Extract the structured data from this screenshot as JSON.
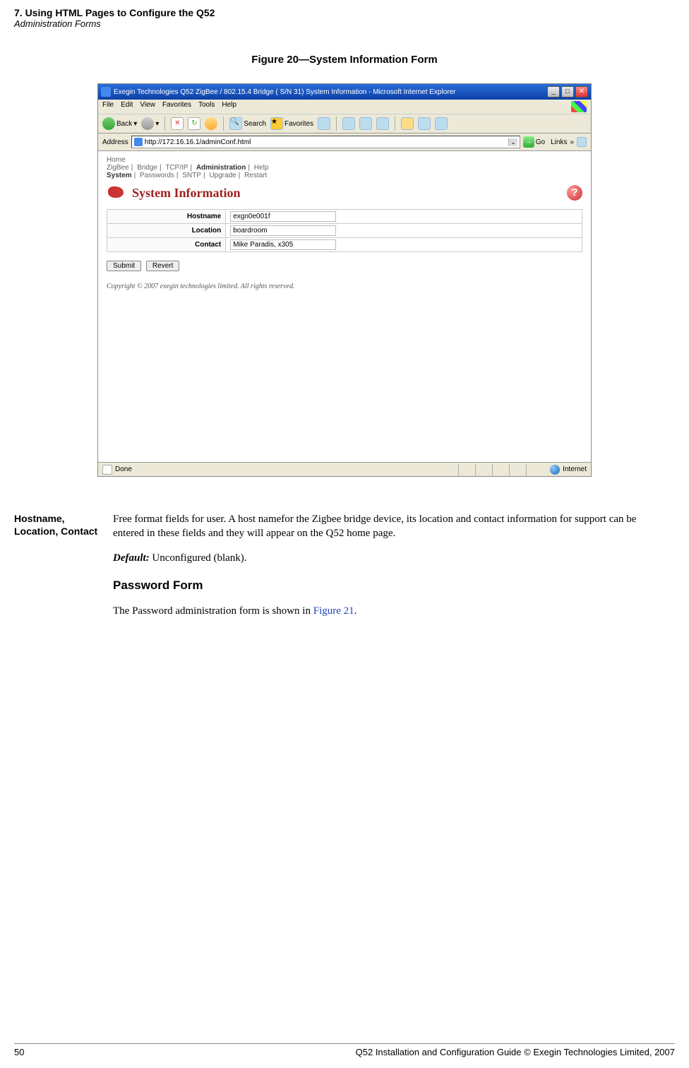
{
  "header": {
    "chapter": "7. Using HTML Pages to Configure the Q52",
    "section": "Administration Forms"
  },
  "figure": {
    "caption": "Figure 20—System Information Form"
  },
  "browser": {
    "title": "Exegin Technologies Q52 ZigBee / 802.15.4 Bridge ( S/N 31) System Information - Microsoft Internet Explorer",
    "menu": {
      "file": "File",
      "edit": "Edit",
      "view": "View",
      "favorites": "Favorites",
      "tools": "Tools",
      "help": "Help"
    },
    "toolbar": {
      "back": "Back",
      "search": "Search",
      "favorites": "Favorites"
    },
    "address": {
      "label": "Address",
      "url": "http://172.16.16.1/adminConf.html",
      "go": "Go",
      "links": "Links"
    },
    "nav": {
      "home": "Home",
      "line2": {
        "zigbee": "ZigBee",
        "bridge": "Bridge",
        "tcpip": "TCP/IP",
        "admin": "Administration",
        "help": "Help"
      },
      "line3": {
        "system": "System",
        "passwords": "Passwords",
        "sntp": "SNTP",
        "upgrade": "Upgrade",
        "restart": "Restart"
      }
    },
    "page": {
      "title": "System Information",
      "help_tooltip": "?",
      "fields": {
        "hostname_label": "Hostname",
        "hostname_value": "exgn0e001f",
        "location_label": "Location",
        "location_value": "boardroom",
        "contact_label": "Contact",
        "contact_value": "Mike Paradis, x305"
      },
      "buttons": {
        "submit": "Submit",
        "revert": "Revert"
      },
      "copyright": "Copyright © 2007 exegin technologies limited. All rights reserved."
    },
    "status": {
      "done": "Done",
      "zone": "Internet"
    }
  },
  "body": {
    "margin_label": "Hostname, Location, Contact",
    "para1": "Free format fields for user. A host namefor the Zigbee bridge device, its location and contact information for support can be entered in these fields and they will appear on the Q52 home page.",
    "default_label": "Default:",
    "default_text": " Unconfigured (blank).",
    "heading": "Password Form",
    "para2a": "The Password administration form is shown in ",
    "figref": "Figure 21",
    "para2b": "."
  },
  "footer": {
    "page_num": "50",
    "text": "Q52 Installation and Configuration Guide  © Exegin Technologies Limited, 2007"
  }
}
